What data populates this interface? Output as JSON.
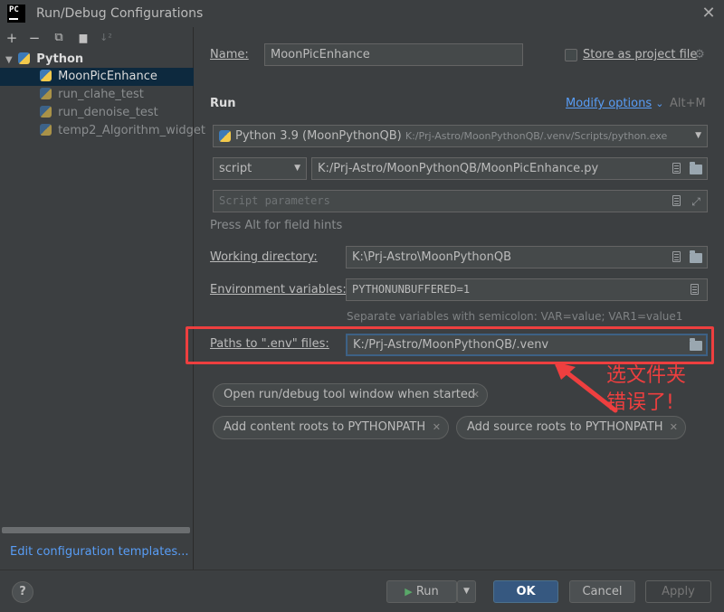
{
  "window": {
    "logo": "PC",
    "title": "Run/Debug Configurations",
    "close": "✕"
  },
  "toolbar": {
    "add": "+",
    "remove": "−",
    "copy": "⧉",
    "folder": "▆",
    "sort": "↓²"
  },
  "tree": {
    "group": "Python",
    "items": [
      {
        "label": "MoonPicEnhance",
        "selected": true
      },
      {
        "label": "run_clahe_test"
      },
      {
        "label": "run_denoise_test"
      },
      {
        "label": "temp2_Algorithm_widget"
      }
    ],
    "edit_templates": "Edit configuration templates..."
  },
  "form": {
    "name_label": "Name:",
    "name_value": "MoonPicEnhance",
    "store_label": "Store as project file",
    "run_heading": "Run",
    "modify_options": "Modify options",
    "modify_chevron": "⌄",
    "modify_shortcut": "Alt+M",
    "interpreter_name": "Python 3.9 (MoonPythonQB)",
    "interpreter_path": "K:/Prj-Astro/MoonPythonQB/.venv/Scripts/python.exe",
    "script_type": "script",
    "script_path": "K:/Prj-Astro/MoonPythonQB/MoonPicEnhance.py",
    "script_params_placeholder": "Script parameters",
    "hint": "Press Alt for field hints",
    "workdir_label": "Working directory:",
    "workdir_value": "K:\\Prj-Astro\\MoonPythonQB",
    "env_label": "Environment variables:",
    "env_value": "PYTHONUNBUFFERED=1",
    "env_hint": "Separate variables with semicolon: VAR=value; VAR1=value1",
    "dotenv_label": "Paths to \".env\" files:",
    "dotenv_value": "K:/Prj-Astro/MoonPythonQB/.venv"
  },
  "chips": [
    {
      "label": "Open run/debug tool window when started"
    },
    {
      "label": "Add content roots to PYTHONPATH"
    },
    {
      "label": "Add source roots to PYTHONPATH"
    }
  ],
  "annotation": {
    "line1": "选文件夹",
    "line2": "错误了!",
    "color": "#ee3f3f"
  },
  "buttons": {
    "help": "?",
    "run": "Run",
    "ok": "OK",
    "cancel": "Cancel",
    "apply": "Apply"
  }
}
